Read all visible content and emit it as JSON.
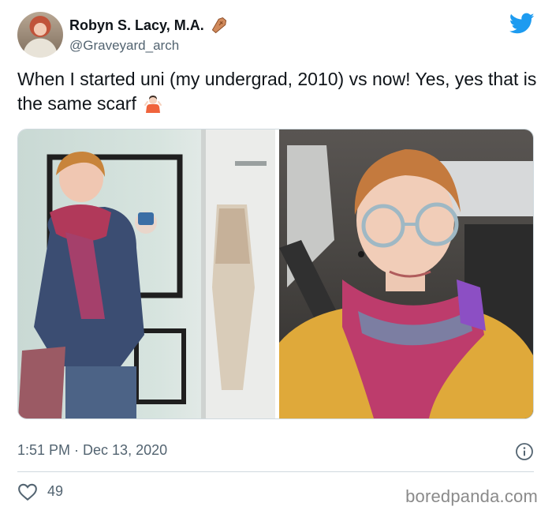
{
  "author": {
    "name": "Robyn S. Lacy, M.A.",
    "handle": "@Graveyard_arch",
    "name_emoji": "coffin-icon"
  },
  "tweet": {
    "text": "When I started uni (my undergrad, 2010) vs now! Yes, yes that is the same scarf",
    "trailing_emoji": "person-shrugging-icon"
  },
  "media": {
    "photos": [
      {
        "name": "photo-left-2010"
      },
      {
        "name": "photo-right-now"
      }
    ]
  },
  "meta": {
    "timestamp": "1:51 PM · Dec 13, 2020"
  },
  "engagement": {
    "likes": "49"
  },
  "watermark": "boredpanda.com",
  "colors": {
    "twitter_blue": "#1d9bf0",
    "secondary_text": "#536471",
    "divider": "#cfd9de"
  }
}
